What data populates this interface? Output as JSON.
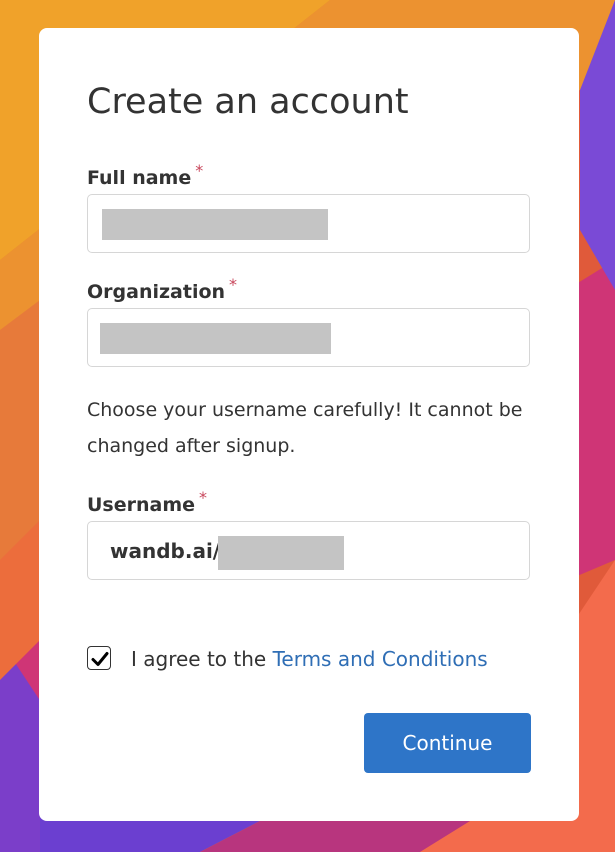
{
  "form": {
    "title": "Create an account",
    "required_marker": "*",
    "full_name": {
      "label": "Full name",
      "value": ""
    },
    "organization": {
      "label": "Organization",
      "value": ""
    },
    "username_hint": "Choose your username carefully! It cannot be changed after signup.",
    "username": {
      "label": "Username",
      "prefix": "wandb.ai/",
      "value": ""
    },
    "agree": {
      "checked": true,
      "text": "I agree to the ",
      "link_text": "Terms and Conditions"
    },
    "continue_label": "Continue"
  },
  "colors": {
    "accent": "#2e75c8",
    "link": "#2f6eb5",
    "required": "#c8465b",
    "redaction": "#c4c4c4"
  }
}
